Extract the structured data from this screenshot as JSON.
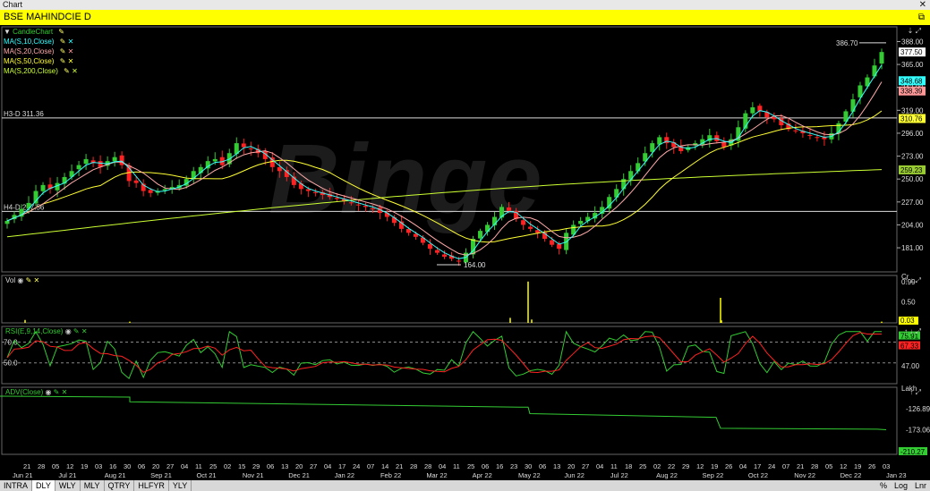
{
  "window": {
    "title": "Chart"
  },
  "symbol_bar": {
    "label": "BSE MAHINDCIE D",
    "restore_icon": "restore-icon"
  },
  "legend": [
    {
      "label": "CandleChart",
      "color": "#33cc33"
    },
    {
      "label": "MA(S,10,Close)",
      "color": "#33ffff"
    },
    {
      "label": "MA(S,20,Close)",
      "color": "#ffaaaa"
    },
    {
      "label": "MA(S,50,Close)",
      "color": "#ffff33"
    },
    {
      "label": "MA(S,200,Close)",
      "color": "#ccff33"
    }
  ],
  "price_pane": {
    "hlines": [
      {
        "label": "H3-D 311.36",
        "value": 311.36
      },
      {
        "label": "H4-D 217.56",
        "value": 217.56
      }
    ],
    "annotations": [
      {
        "label": "386.70",
        "value": 386.7
      },
      {
        "label": "164.00",
        "value": 164.0
      }
    ],
    "axis_ticks": [
      "388.00",
      "365.00",
      "342.00",
      "319.00",
      "296.00",
      "273.00",
      "250.00",
      "227.00",
      "204.00",
      "181.00"
    ],
    "price_badges": [
      {
        "label": "377.50",
        "bg": "#ffffff",
        "fg": "#000000",
        "value": 377.5
      },
      {
        "label": "348.68",
        "bg": "#33ffff",
        "fg": "#000000",
        "value": 348.68
      },
      {
        "label": "338.39",
        "bg": "#ff9999",
        "fg": "#000000",
        "value": 338.39
      },
      {
        "label": "310.76",
        "bg": "#ffff33",
        "fg": "#000000",
        "value": 310.76
      },
      {
        "label": "259.23",
        "bg": "#99cc33",
        "fg": "#000000",
        "value": 259.23
      }
    ],
    "watermark": "Binge"
  },
  "vol_pane": {
    "label": "Vol",
    "unit": "Cr",
    "ticks": [
      "0.99",
      "0.50"
    ],
    "badge": "0.03"
  },
  "rsi_pane": {
    "label": "RSI(E,9,14,Close)",
    "levels": [
      "70.0",
      "50.0"
    ],
    "ticks": [
      "47.00"
    ],
    "badges": [
      "75.91",
      "67.33"
    ]
  },
  "adv_pane": {
    "label": "ADV(Close)",
    "unit": "Lakh",
    "ticks": [
      "-126.89",
      "-173.06"
    ],
    "badge": "-210.27"
  },
  "x_axis": {
    "days": [
      "21",
      "28",
      "05",
      "12",
      "19",
      "03",
      "16",
      "30",
      "06",
      "20",
      "27",
      "04",
      "11",
      "25",
      "02",
      "15",
      "29",
      "06",
      "13",
      "20",
      "27",
      "04",
      "17",
      "24",
      "07",
      "14",
      "21",
      "28",
      "28",
      "04",
      "11",
      "25",
      "06",
      "16",
      "23",
      "30",
      "06",
      "13",
      "20",
      "27",
      "04",
      "11",
      "18",
      "25",
      "02",
      "22",
      "29",
      "12",
      "19",
      "26",
      "04",
      "17",
      "24",
      "07",
      "21",
      "28",
      "05",
      "12",
      "19",
      "26",
      "03"
    ],
    "months": [
      "Jun 21",
      "Jul 21",
      "Aug 21",
      "Sep 21",
      "Oct 21",
      "Nov 21",
      "Dec 21",
      "Jan 22",
      "Feb 22",
      "Mar 22",
      "Apr 22",
      "May 22",
      "Jun 22",
      "Jul 22",
      "Aug 22",
      "Sep 22",
      "Oct 22",
      "Nov 22",
      "Dec 22",
      "Jan 23"
    ]
  },
  "tabs": [
    "INTRA",
    "DLY",
    "WLY",
    "MLY",
    "QTRY",
    "HLFYR",
    "YLY"
  ],
  "active_tab": "DLY",
  "tabs_right": [
    "%",
    "Log",
    "Lnr"
  ],
  "chart_data": {
    "type": "candlestick",
    "title": "BSE MAHINDCIE D",
    "ylim": [
      164,
      392
    ],
    "series_close": [
      208,
      214,
      220,
      226,
      238,
      244,
      240,
      246,
      252,
      258,
      264,
      270,
      266,
      262,
      268,
      272,
      264,
      248,
      246,
      238,
      236,
      238,
      240,
      242,
      244,
      250,
      258,
      262,
      268,
      270,
      264,
      276,
      286,
      282,
      280,
      276,
      270,
      262,
      258,
      252,
      244,
      240,
      238,
      236,
      234,
      232,
      230,
      228,
      226,
      224,
      222,
      220,
      216,
      212,
      206,
      200,
      196,
      192,
      186,
      180,
      176,
      172,
      170,
      168,
      176,
      190,
      198,
      204,
      212,
      222,
      218,
      210,
      204,
      200,
      196,
      190,
      184,
      180,
      196,
      204,
      208,
      212,
      216,
      222,
      232,
      240,
      250,
      258,
      266,
      276,
      286,
      292,
      286,
      282,
      278,
      282,
      286,
      290,
      294,
      288,
      282,
      290,
      302,
      316,
      322,
      318,
      312,
      310,
      304,
      300,
      298,
      296,
      294,
      292,
      290,
      296,
      306,
      318,
      330,
      344,
      352,
      364,
      377.5
    ],
    "ma10_end": 348.68,
    "ma20_end": 338.39,
    "ma50_end": 310.76,
    "ma200_end": 259.23,
    "vol_spikes": [
      0.07,
      0.03,
      0.99,
      0.12,
      0.08,
      0.6,
      0.06,
      0.03
    ],
    "rsi_last": 75.91,
    "rsi_signal_last": 67.33,
    "adv_last": -210.27
  }
}
